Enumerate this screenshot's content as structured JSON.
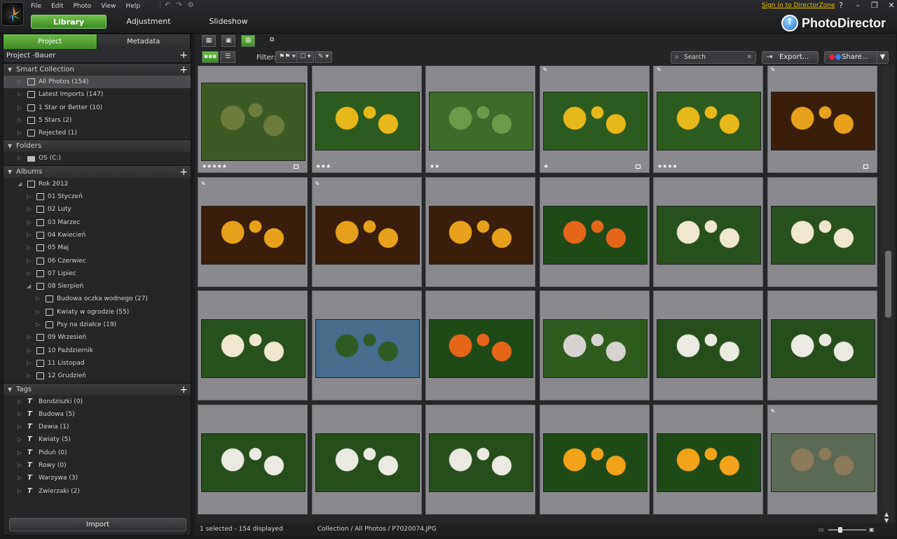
{
  "menu": [
    "File",
    "Edit",
    "Photo",
    "View",
    "Help"
  ],
  "modes": {
    "library": "Library",
    "adjustment": "Adjustment",
    "slideshow": "Slideshow"
  },
  "signin": "Sign in to DirectorZone",
  "window_controls": [
    "?",
    "–",
    "❐",
    "✕"
  ],
  "brand": "PhotoDirector",
  "panel_tabs": {
    "project": "Project",
    "metadata": "Metadata"
  },
  "project_name": "Project -Bauer",
  "smart_collection": {
    "title": "Smart Collection",
    "items": [
      "All Photos (154)",
      "Latest Imports (147)",
      "1 Star or Better (10)",
      "5 Stars (2)",
      "Rejected (1)"
    ]
  },
  "folders": {
    "title": "Folders",
    "items": [
      "OS (C:)"
    ]
  },
  "albums": {
    "title": "Albums",
    "year": "Rok 2012",
    "months": [
      "01 Styczeń",
      "02 Luty",
      "03 Marzec",
      "04 Kwiecień",
      "05 Maj",
      "06 Czerwiec",
      "07 Lipiec",
      "08 Sierpień"
    ],
    "sub": [
      "Budowa oczka wodnego (27)",
      "Kwiaty w ogrodzie (55)",
      "Psy na działce (19)"
    ],
    "months_after": [
      "09 Wrzesień",
      "10 Październik",
      "11 Listopad",
      "12 Grudzień"
    ]
  },
  "tags": {
    "title": "Tags",
    "items": [
      "Bondziszki (0)",
      "Budowa (5)",
      "Dawia (1)",
      "Kwiaty (5)",
      "Piduń (0)",
      "Rowy (0)",
      "Warzywa (3)",
      "Zwierzaki (2)"
    ]
  },
  "import_label": "Import",
  "filter_label": "Filter:",
  "search_placeholder": "Search",
  "export_label": "Export...",
  "share_label": "Share...",
  "status": {
    "selected": "1 selected - 154 displayed",
    "path": "Collection / All Photos / P7020074.JPG"
  },
  "thumbnails": [
    {
      "kind": "dog",
      "stars": "★★★★★",
      "flag": true,
      "edited": false
    },
    {
      "kind": "yellow",
      "stars": "★★★",
      "flag": false,
      "edited": false
    },
    {
      "kind": "garden",
      "stars": "★★",
      "flag": false,
      "edited": false
    },
    {
      "kind": "yellow",
      "stars": "★",
      "flag": true,
      "edited": true
    },
    {
      "kind": "yellow",
      "stars": "★★★★",
      "flag": false,
      "edited": true
    },
    {
      "kind": "blackeyed",
      "stars": "",
      "flag": true,
      "edited": true
    },
    {
      "kind": "blackeyed",
      "stars": "",
      "flag": false,
      "edited": true
    },
    {
      "kind": "blackeyed",
      "stars": "",
      "flag": false,
      "edited": true
    },
    {
      "kind": "blackeyed",
      "stars": "",
      "flag": false,
      "edited": false
    },
    {
      "kind": "lily",
      "stars": "",
      "flag": false,
      "edited": false
    },
    {
      "kind": "dahlia",
      "stars": "",
      "flag": false,
      "edited": false
    },
    {
      "kind": "dahlia",
      "stars": "",
      "flag": false,
      "edited": false
    },
    {
      "kind": "dahlia",
      "stars": "",
      "flag": false,
      "edited": false
    },
    {
      "kind": "sky",
      "stars": "",
      "flag": false,
      "edited": false
    },
    {
      "kind": "lily",
      "stars": "",
      "flag": false,
      "edited": false
    },
    {
      "kind": "fence",
      "stars": "",
      "flag": false,
      "edited": false
    },
    {
      "kind": "hydrangea",
      "stars": "",
      "flag": false,
      "edited": false
    },
    {
      "kind": "hydrangea",
      "stars": "",
      "flag": false,
      "edited": false
    },
    {
      "kind": "hydrangea",
      "stars": "",
      "flag": false,
      "edited": false
    },
    {
      "kind": "hydrangea",
      "stars": "",
      "flag": false,
      "edited": false
    },
    {
      "kind": "hydrangea",
      "stars": "",
      "flag": false,
      "edited": false
    },
    {
      "kind": "marigold",
      "stars": "",
      "flag": false,
      "edited": false
    },
    {
      "kind": "marigold",
      "stars": "",
      "flag": false,
      "edited": false
    },
    {
      "kind": "house",
      "stars": "",
      "flag": false,
      "edited": true
    }
  ],
  "colors": {
    "accent": "#4fa32e",
    "signin": "#e8c200"
  }
}
